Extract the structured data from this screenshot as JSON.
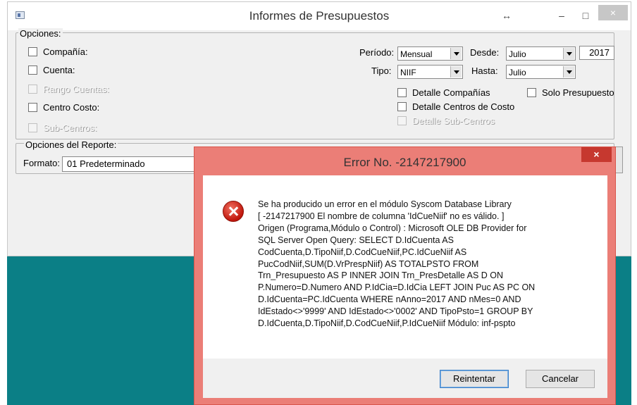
{
  "window": {
    "title": "Informes de Presupuestos",
    "resize_glyph": "↔",
    "minimize": "–",
    "maximize": "□",
    "close": "×"
  },
  "opciones": {
    "legend": "Opciones:",
    "left_checks": [
      {
        "label": "Compañía:",
        "checked": false,
        "enabled": true
      },
      {
        "label": "Cuenta:",
        "checked": false,
        "enabled": true
      },
      {
        "label": "Rango Cuentas:",
        "checked": false,
        "enabled": false
      },
      {
        "label": "Centro Costo:",
        "checked": false,
        "enabled": true
      },
      {
        "label": "Sub-Centros:",
        "checked": false,
        "enabled": false
      }
    ],
    "periodo_label": "Período:",
    "periodo_value": "Mensual",
    "tipo_label": "Tipo:",
    "tipo_value": "NIIF",
    "desde_label": "Desde:",
    "desde_value": "Julio",
    "year_value": "2017",
    "hasta_label": "Hasta:",
    "hasta_value": "Julio",
    "detalle_companias": "Detalle Compañías",
    "solo_presupuesto": "Solo Presupuesto",
    "detalle_centros": "Detalle Centros de Costo",
    "detalle_subcentros": "Detalle Sub-Centros"
  },
  "reporte": {
    "legend": "Opciones del Reporte:",
    "formato_label": "Formato:",
    "formato_value": "01 Predeterminado"
  },
  "dialog": {
    "title": "Error No. -2147217900",
    "close": "×",
    "icon": "error-icon",
    "message": "Se ha producido un error en el módulo Syscom Database Library\n[ -2147217900  El nombre de columna 'IdCueNiif' no es válido. ]\n Origen (Programa,Módulo o Control) : Microsoft OLE DB Provider for\nSQL Server Open Query: SELECT D.IdCuenta AS\nCodCuenta,D.TipoNiif,D.CodCueNiif,PC.IdCueNiif AS\nPucCodNiif,SUM(D.VrPrespNiif) AS TOTALPSTO FROM\nTrn_Presupuesto AS P INNER JOIN Trn_PresDetalle AS D ON\nP.Numero=D.Numero AND P.IdCia=D.IdCia LEFT JOIN Puc AS PC ON\nD.IdCuenta=PC.IdCuenta WHERE nAnno=2017 AND nMes=0 AND\nIdEstado<>'9999' AND IdEstado<>'0002' AND TipoPsto=1 GROUP BY\nD.IdCuenta,D.TipoNiif,D.CodCueNiif,P.IdCueNiif Módulo: inf-pspto",
    "retry_label": "Reintentar",
    "cancel_label": "Cancelar"
  }
}
